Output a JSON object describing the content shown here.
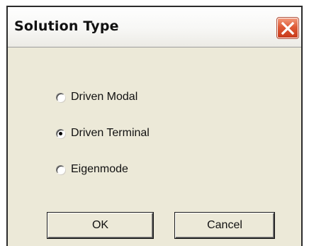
{
  "dialog": {
    "title": "Solution Type",
    "options": [
      {
        "label": "Driven Modal",
        "checked": false
      },
      {
        "label": "Driven Terminal",
        "checked": true
      },
      {
        "label": "Eigenmode",
        "checked": false
      }
    ],
    "ok_label": "OK",
    "cancel_label": "Cancel"
  },
  "colors": {
    "dialog_background": "#ece9d8",
    "close_button": "#de5a37",
    "border": "#2b2b2b"
  },
  "icons": {
    "close": "close-icon"
  }
}
